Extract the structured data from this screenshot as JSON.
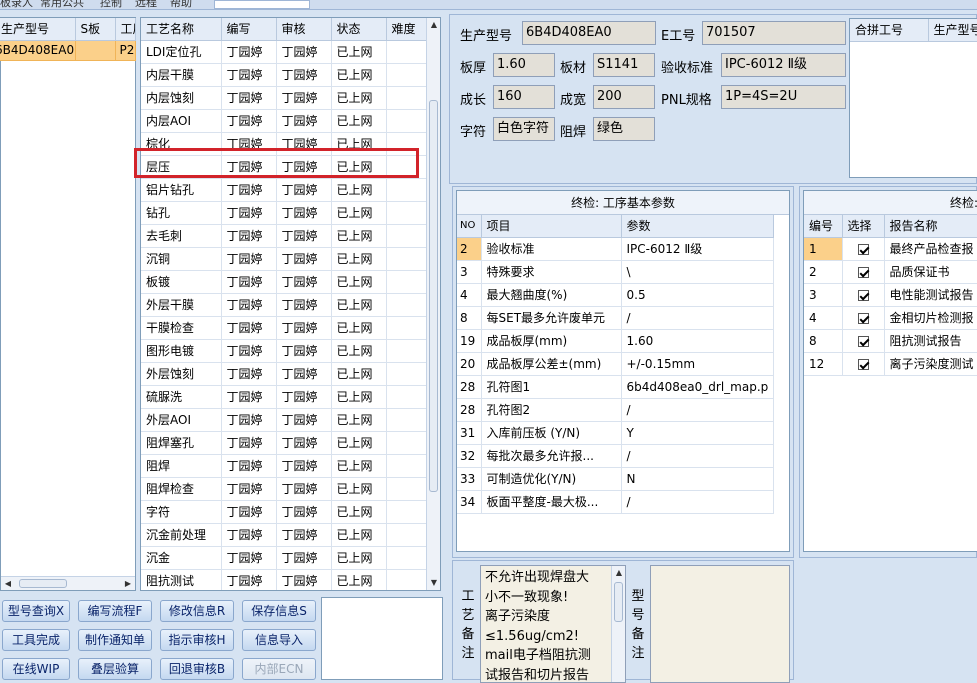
{
  "top_tabs": [
    "板录人",
    "常用公共",
    "控制",
    "远程",
    "帮助"
  ],
  "left_list": {
    "headers": [
      "生产型号",
      "S板",
      "工厂"
    ],
    "rows": [
      [
        "6B4D408EA0",
        "",
        "P2"
      ]
    ]
  },
  "process_table": {
    "headers": [
      "工艺名称",
      "编写",
      "审核",
      "状态",
      "难度"
    ],
    "rows": [
      [
        "LDI定位孔",
        "丁园婷",
        "丁园婷",
        "已上网",
        ""
      ],
      [
        "内层干膜",
        "丁园婷",
        "丁园婷",
        "已上网",
        ""
      ],
      [
        "内层蚀刻",
        "丁园婷",
        "丁园婷",
        "已上网",
        ""
      ],
      [
        "内层AOI",
        "丁园婷",
        "丁园婷",
        "已上网",
        ""
      ],
      [
        "棕化",
        "丁园婷",
        "丁园婷",
        "已上网",
        ""
      ],
      [
        "层压",
        "丁园婷",
        "丁园婷",
        "已上网",
        ""
      ],
      [
        "铝片钻孔",
        "丁园婷",
        "丁园婷",
        "已上网",
        ""
      ],
      [
        "钻孔",
        "丁园婷",
        "丁园婷",
        "已上网",
        ""
      ],
      [
        "去毛刺",
        "丁园婷",
        "丁园婷",
        "已上网",
        ""
      ],
      [
        "沉铜",
        "丁园婷",
        "丁园婷",
        "已上网",
        ""
      ],
      [
        "板镀",
        "丁园婷",
        "丁园婷",
        "已上网",
        ""
      ],
      [
        "外层干膜",
        "丁园婷",
        "丁园婷",
        "已上网",
        ""
      ],
      [
        "干膜检查",
        "丁园婷",
        "丁园婷",
        "已上网",
        ""
      ],
      [
        "图形电镀",
        "丁园婷",
        "丁园婷",
        "已上网",
        ""
      ],
      [
        "外层蚀刻",
        "丁园婷",
        "丁园婷",
        "已上网",
        ""
      ],
      [
        "硫脲洗",
        "丁园婷",
        "丁园婷",
        "已上网",
        ""
      ],
      [
        "外层AOI",
        "丁园婷",
        "丁园婷",
        "已上网",
        ""
      ],
      [
        "阻焊塞孔",
        "丁园婷",
        "丁园婷",
        "已上网",
        ""
      ],
      [
        "阻焊",
        "丁园婷",
        "丁园婷",
        "已上网",
        ""
      ],
      [
        "阻焊检查",
        "丁园婷",
        "丁园婷",
        "已上网",
        ""
      ],
      [
        "字符",
        "丁园婷",
        "丁园婷",
        "已上网",
        ""
      ],
      [
        "沉金前处理",
        "丁园婷",
        "丁园婷",
        "已上网",
        ""
      ],
      [
        "沉金",
        "丁园婷",
        "丁园婷",
        "已上网",
        ""
      ],
      [
        "阻抗测试",
        "丁园婷",
        "丁园婷",
        "已上网",
        ""
      ]
    ],
    "highlighted_row": "层压"
  },
  "info": {
    "model_label": "生产型号",
    "model_value": "6B4D408EA0",
    "e_label": "E工号",
    "e_value": "701507",
    "thick_label": "板厚",
    "thick_value": "1.60",
    "mat_label": "板材",
    "mat_value": "S1141",
    "std_label": "验收标准",
    "std_value": "IPC-6012 Ⅱ级",
    "grow_label": "成长",
    "grow_value": "160",
    "width_label": "成宽",
    "width_value": "200",
    "pnl_label": "PNL规格",
    "pnl_value": "1P=4S=2U",
    "char_label": "字符",
    "char_value": "白色字符",
    "mask_label": "阻焊",
    "mask_value": "绿色"
  },
  "merge_table": {
    "headers": [
      "合拼工号",
      "生产型号"
    ]
  },
  "params": {
    "title": "终检: 工序基本参数",
    "headers": [
      "NO",
      "项目",
      "参数"
    ],
    "rows": [
      [
        "2",
        "验收标准",
        "IPC-6012 Ⅱ级"
      ],
      [
        "3",
        "特殊要求",
        "\\"
      ],
      [
        "4",
        "最大翘曲度(%)",
        "0.5"
      ],
      [
        "8",
        "每SET最多允许废单元",
        "/"
      ],
      [
        "19",
        "成品板厚(mm)",
        "1.60"
      ],
      [
        "20",
        "成品板厚公差±(mm)",
        "+/-0.15mm"
      ],
      [
        "28",
        "孔符图1",
        "6b4d408ea0_drl_map.p"
      ],
      [
        "28",
        "孔符图2",
        "/"
      ],
      [
        "31",
        "入库前压板 (Y/N)",
        "Y"
      ],
      [
        "32",
        "每批次最多允许报...",
        "/"
      ],
      [
        "33",
        "可制造优化(Y/N)",
        "N"
      ],
      [
        "34",
        "板面平整度-最大极...",
        "/"
      ]
    ]
  },
  "reports": {
    "title": "终检:",
    "headers": [
      "编号",
      "选择",
      "报告名称"
    ],
    "rows": [
      [
        "1",
        "最终产品检查报"
      ],
      [
        "2",
        "品质保证书"
      ],
      [
        "3",
        "电性能测试报告"
      ],
      [
        "4",
        "金相切片检测报"
      ],
      [
        "8",
        "阻抗测试报告"
      ],
      [
        "12",
        "离子污染度测试"
      ]
    ]
  },
  "notes": {
    "craft_label": [
      "工",
      "艺",
      "备",
      "注"
    ],
    "craft_text": [
      "不允许出现焊盘大",
      "小不一致现象!",
      "离子污染度",
      "≤1.56ug/cm2!",
      "mail电子档阻抗测",
      "试报告和切片报告"
    ],
    "model_label": [
      "型",
      "号",
      "备",
      "注"
    ]
  },
  "buttons": {
    "query": "型号查询X",
    "edit_flow": "编写流程F",
    "modify": "修改信息R",
    "save": "保存信息S",
    "done": "工具完成",
    "notice": "制作通知单",
    "review": "指示审核H",
    "import": "信息导入",
    "wip": "在线WIP",
    "stack": "叠层验算",
    "revert": "回退审核B",
    "ecn": "内部ECN"
  }
}
